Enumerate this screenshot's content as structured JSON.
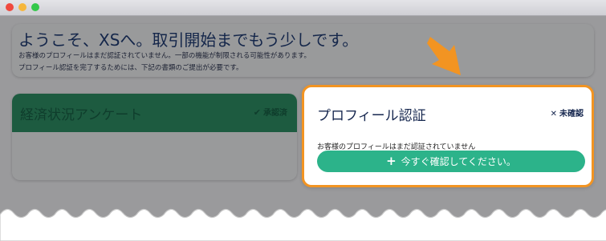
{
  "welcome": {
    "title": "ようこそ、XSへ。取引開始までもう少しです。",
    "desc1": "お客様のプロフィールはまだ認証されていません。一部の機能が制限される可能性があります。",
    "desc2": "プロフィール認証を完了するためには、下記の書類のご提出が必要です。"
  },
  "survey_card": {
    "title": "経済状況アンケート",
    "status": "承認済",
    "status_icon": "check-icon"
  },
  "profile_card": {
    "title": "プロフィール認証",
    "status": "未確認",
    "status_icon": "x-icon",
    "note": "お客様のプロフィールはまだ認証されていません",
    "button_label": "今すぐ確認してください。",
    "button_icon": "plus-icon"
  },
  "colors": {
    "accent_orange": "#f29422",
    "button_green": "#2cb38a",
    "approved_header": "#1d5b40",
    "title_navy": "#16274f"
  }
}
